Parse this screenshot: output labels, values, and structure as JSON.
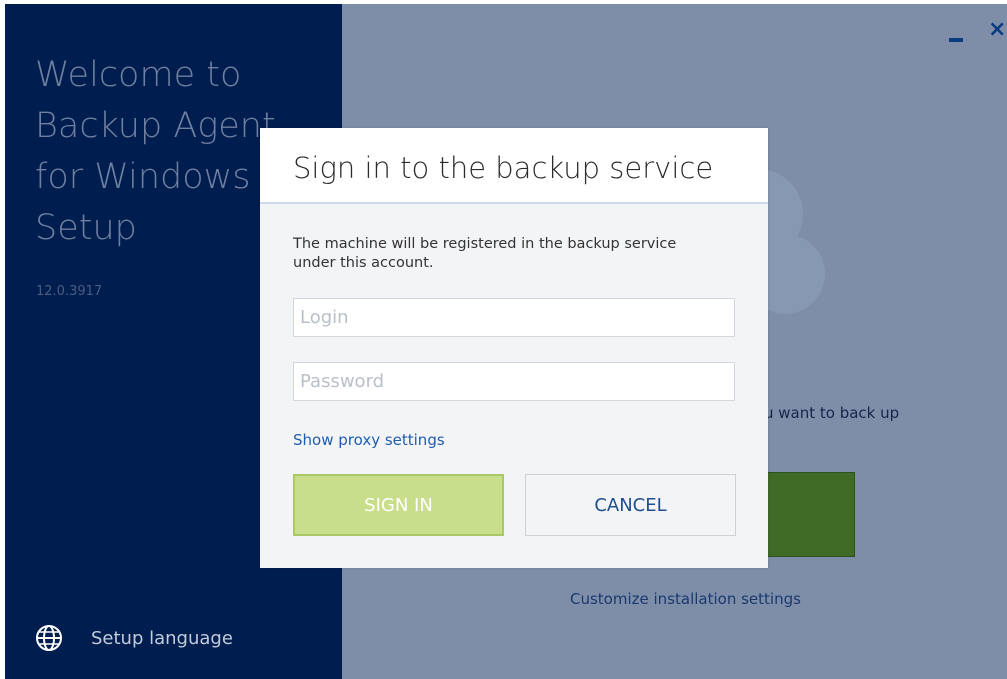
{
  "sidebar": {
    "welcome_lines": [
      "Welcome to",
      "Backup Agent",
      "for Windows",
      "Setup"
    ],
    "version": "12.0.3917",
    "language_label": "Setup language",
    "language_icon": "globe-icon"
  },
  "window_controls": {
    "minimize_icon": "minimize-icon",
    "close_symbol": "×"
  },
  "background": {
    "description_partial": "u want to back up",
    "customize_link": "Customize installation settings"
  },
  "dialog": {
    "title": "Sign in to the backup service",
    "description": "The machine will be registered in the backup service under this account.",
    "login_placeholder": "Login",
    "login_value": "",
    "password_placeholder": "Password",
    "password_value": "",
    "proxy_link": "Show proxy settings",
    "signin_label": "SIGN IN",
    "cancel_label": "CANCEL"
  },
  "colors": {
    "sidebar_bg": "#001d4f",
    "main_bg": "#7e8ea8",
    "signin_bg": "#c8de8a",
    "install_button_bg": "#3f6b27",
    "link": "#1f5cb0"
  }
}
